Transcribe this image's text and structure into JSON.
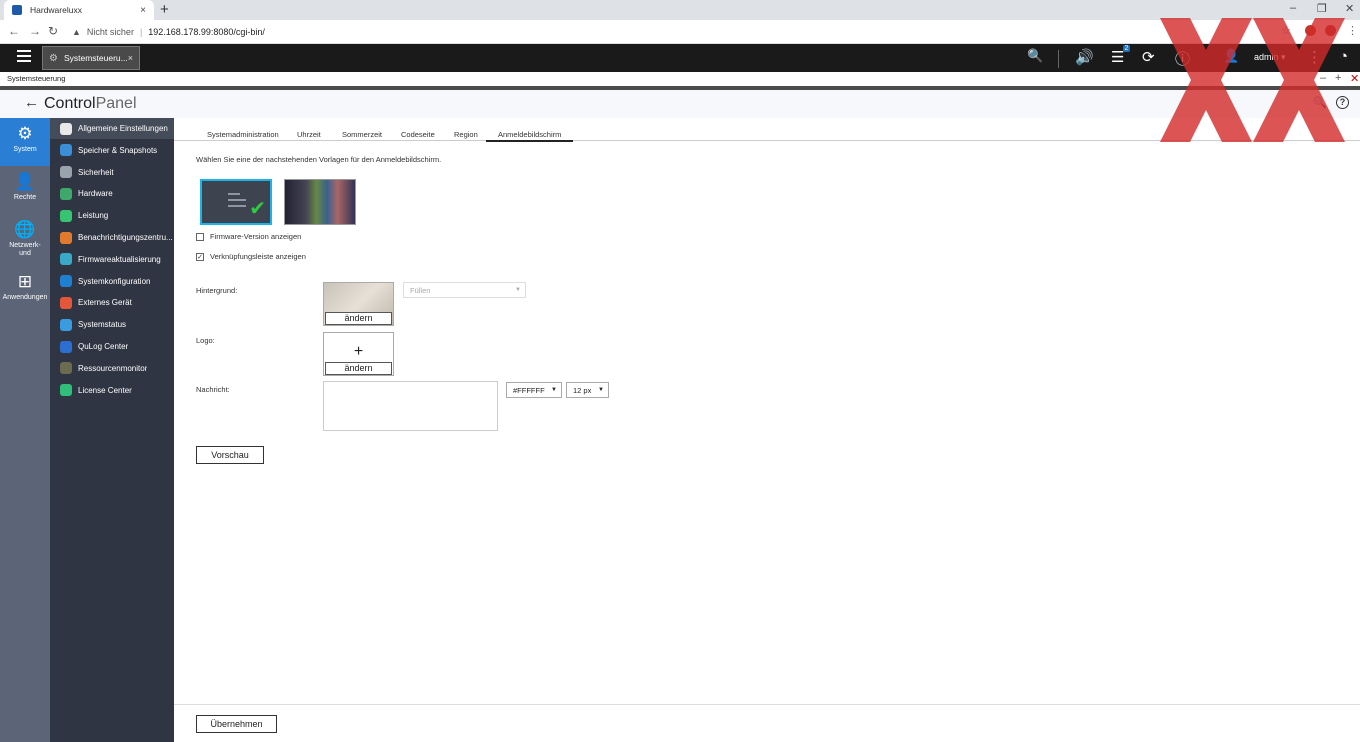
{
  "browser": {
    "tab_title": "Hardwareluxx",
    "close_glyph": "×",
    "new_tab_glyph": "+",
    "security_label": "Nicht sicher",
    "separator": "|",
    "url": "192.168.178.99:8080/cgi-bin/",
    "warning_glyph": "▲",
    "win_min": "–",
    "win_restore": "❐",
    "win_close": "✕",
    "back_glyph": "←",
    "forward_glyph": "→",
    "reload_glyph": "↻",
    "star_glyph": "☆",
    "menu_glyph": "⋮"
  },
  "qts": {
    "app_tab_title": "Systemsteueru...",
    "app_tab_close": "×",
    "gear_glyph": "⚙",
    "search_glyph": "🔍",
    "volume_glyph": "🔊",
    "tasks_glyph": "☰",
    "tasks_badge": "2",
    "sync_glyph": "⟳",
    "info_glyph": "ⓘ",
    "user_glyph": "👤",
    "user_name": "admin",
    "user_caret": "▾",
    "more_glyph": "⋮",
    "dashboard_glyph": "◔"
  },
  "window": {
    "title": "Systemsteuerung",
    "min_glyph": "–",
    "max_glyph": "+",
    "close_glyph": "✕"
  },
  "header": {
    "back_glyph": "←",
    "title_bold": "Control",
    "title_light": "Panel",
    "search_glyph": "🔍",
    "help_glyph": "?"
  },
  "rail": [
    {
      "label": "System",
      "glyph": "⚙"
    },
    {
      "label": "Rechte",
      "glyph": "👤"
    },
    {
      "label": "Netzwerk- und",
      "glyph": "🌐"
    },
    {
      "label": "Anwendungen",
      "glyph": "⊞"
    }
  ],
  "sidebar": [
    {
      "label": "Allgemeine Einstellungen",
      "color": "#e8e8e8"
    },
    {
      "label": "Speicher & Snapshots",
      "color": "#3a8fd8"
    },
    {
      "label": "Sicherheit",
      "color": "#9aa3ad"
    },
    {
      "label": "Hardware",
      "color": "#3fa96b"
    },
    {
      "label": "Leistung",
      "color": "#35c46f"
    },
    {
      "label": "Benachrichtigungszentru...",
      "color": "#e07b2e"
    },
    {
      "label": "Firmwareaktualisierung",
      "color": "#3aa9c9"
    },
    {
      "label": "Systemkonfiguration",
      "color": "#1f7fd0"
    },
    {
      "label": "Externes Gerät",
      "color": "#e4573a"
    },
    {
      "label": "Systemstatus",
      "color": "#3b9be0"
    },
    {
      "label": "QuLog Center",
      "color": "#2d6fd0"
    },
    {
      "label": "Ressourcenmonitor",
      "color": "#6b6b4f"
    },
    {
      "label": "License Center",
      "color": "#2fbf7a"
    }
  ],
  "tabs": [
    "Systemadministration",
    "Uhrzeit",
    "Sommerzeit",
    "Codeseite",
    "Region",
    "Anmeldebildschirm"
  ],
  "main": {
    "instruction": "Wählen Sie eine der nachstehenden Vorlagen für den Anmeldebildschirm.",
    "firmware_checkbox": "Firmware-Version anzeigen",
    "link_checkbox": "Verknüpfungsleiste anzeigen",
    "checked_glyph": "✓",
    "background_label": "Hintergrund:",
    "change_label": "ändern",
    "fill_select": "Füllen",
    "logo_label": "Logo:",
    "plus_glyph": "+",
    "message_label": "Nachricht:",
    "color_select": "#FFFFFF",
    "size_select": "12 px",
    "select_caret": "▼",
    "preview_button": "Vorschau",
    "apply_button": "Übernehmen",
    "selected_mark": "✔"
  }
}
